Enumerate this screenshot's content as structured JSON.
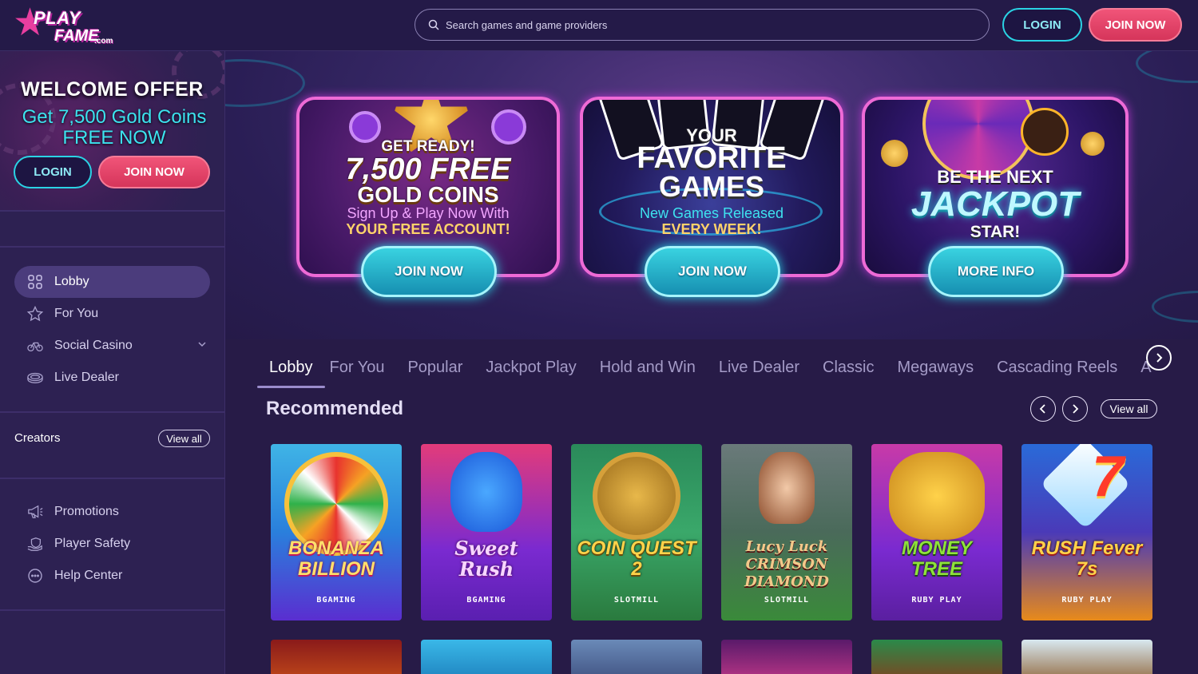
{
  "header": {
    "logo": {
      "line1": "PLAY",
      "line2": "FAME",
      "line3": ".com"
    },
    "search_placeholder": "Search games and game providers",
    "login_label": "LOGIN",
    "join_label": "JOIN NOW"
  },
  "sidebar": {
    "promo": {
      "title": "WELCOME OFFER",
      "subtitle_line1": "Get 7,500 Gold Coins",
      "subtitle_line2": "FREE NOW",
      "login_label": "LOGIN",
      "join_label": "JOIN NOW"
    },
    "nav": [
      {
        "label": "Lobby",
        "icon": "grid-icon",
        "active": true
      },
      {
        "label": "For You",
        "icon": "star-icon"
      },
      {
        "label": "Social Casino",
        "icon": "bike-icon",
        "has_dropdown": true
      },
      {
        "label": "Live Dealer",
        "icon": "table-icon"
      }
    ],
    "creators_label": "Creators",
    "creators_view_all": "View all",
    "bottom_nav": [
      {
        "label": "Promotions",
        "icon": "megaphone-icon"
      },
      {
        "label": "Player Safety",
        "icon": "hand-shield-icon"
      },
      {
        "label": "Help Center",
        "icon": "chat-icon"
      }
    ]
  },
  "hero": {
    "cards": [
      {
        "top": "GET READY!",
        "big": "7,500 FREE",
        "mid": "GOLD COINS",
        "line1": "Sign Up & Play Now With",
        "line2": "YOUR FREE ACCOUNT!",
        "button": "JOIN NOW"
      },
      {
        "top": "YOUR",
        "big": "FAVORITE",
        "mid": "GAMES",
        "line1": "New Games Released",
        "line2": "EVERY WEEK!",
        "button": "JOIN NOW"
      },
      {
        "top": "BE THE NEXT",
        "big": "JACKPOT",
        "mid": "STAR!",
        "button": "MORE INFO"
      }
    ]
  },
  "tabs": [
    "Lobby",
    "For You",
    "Popular",
    "Jackpot Play",
    "Hold and Win",
    "Live Dealer",
    "Classic",
    "Megaways",
    "Cascading Reels",
    "A"
  ],
  "recommended": {
    "title": "Recommended",
    "view_all": "View all",
    "games": [
      {
        "name": "BONANZA BILLION",
        "provider": "BGAMING"
      },
      {
        "name": "Sweet Rush",
        "provider": "BGAMING"
      },
      {
        "name": "COIN QUEST 2",
        "provider": "SLOTMILL"
      },
      {
        "name": "Lucy Luck CRIMSON DIAMOND",
        "provider": "SLOTMILL"
      },
      {
        "name": "MONEY TREE",
        "provider": "RUBY PLAY"
      },
      {
        "name": "RUSH Fever 7s",
        "provider": "RUBY PLAY"
      }
    ]
  },
  "colors": {
    "accent_cyan": "#2ad3e4",
    "accent_pink": "#e8456d",
    "bg": "#241844"
  }
}
